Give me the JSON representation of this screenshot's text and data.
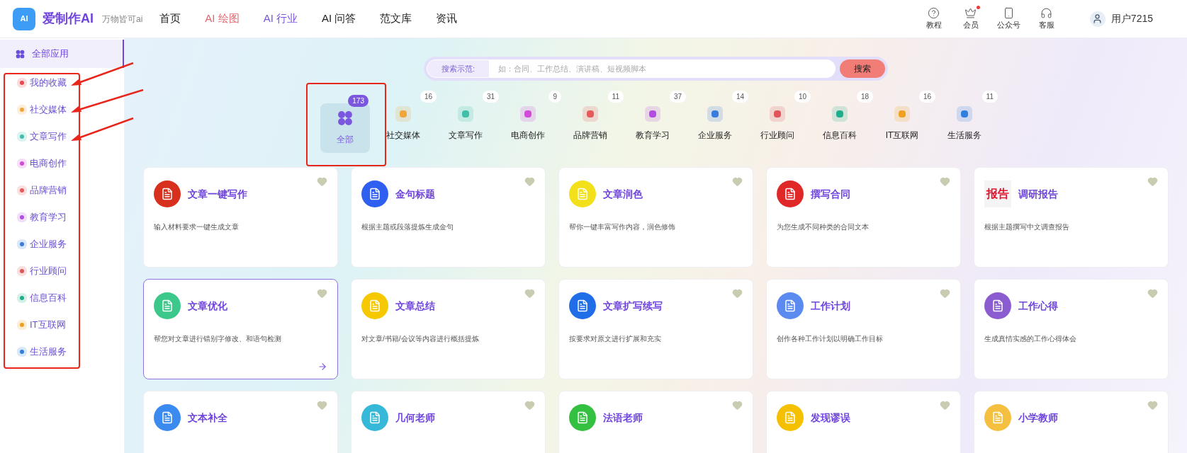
{
  "brand": {
    "name": "爱制作AI",
    "logo_text": "AI",
    "slogan": "万物皆可ai"
  },
  "nav": [
    {
      "label": "首页",
      "color": "#222222"
    },
    {
      "label": "AI 绘图",
      "color": "#e0676d"
    },
    {
      "label": "AI 行业",
      "color": "#7b56de"
    },
    {
      "label": "AI 问答",
      "color": "#222222"
    },
    {
      "label": "范文库",
      "color": "#222222"
    },
    {
      "label": "资讯",
      "color": "#222222"
    }
  ],
  "header_actions": [
    {
      "label": "教程",
      "kind": "help",
      "dot": false
    },
    {
      "label": "会员",
      "kind": "crown",
      "dot": true
    },
    {
      "label": "公众号",
      "kind": "phone",
      "dot": false
    },
    {
      "label": "客服",
      "kind": "headset",
      "dot": false
    }
  ],
  "user": {
    "name": "用户7215"
  },
  "sidebar": [
    {
      "label": "全部应用",
      "selected": true,
      "color": "#6b4fe0"
    },
    {
      "label": "我的收藏",
      "selected": false,
      "color": "#e8474f"
    },
    {
      "label": "社交媒体",
      "selected": false,
      "color": "#f0a53a"
    },
    {
      "label": "文章写作",
      "selected": false,
      "color": "#3fbfa8"
    },
    {
      "label": "电商创作",
      "selected": false,
      "color": "#d24ad8"
    },
    {
      "label": "品牌营销",
      "selected": false,
      "color": "#e55a5a"
    },
    {
      "label": "教育学习",
      "selected": false,
      "color": "#b24fe0"
    },
    {
      "label": "企业服务",
      "selected": false,
      "color": "#3a7be0"
    },
    {
      "label": "行业顾问",
      "selected": false,
      "color": "#e0555a"
    },
    {
      "label": "信息百科",
      "selected": false,
      "color": "#1fae8c"
    },
    {
      "label": "IT互联网",
      "selected": false,
      "color": "#f0a020"
    },
    {
      "label": "生活服务",
      "selected": false,
      "color": "#2f7fe0"
    }
  ],
  "search": {
    "label": "搜索示范:",
    "placeholder": "如：合同、工作总结、演讲稿、短视频脚本",
    "button": "搜索"
  },
  "categories": [
    {
      "label": "全部",
      "count": "173",
      "selected": true,
      "color": "#7b56de"
    },
    {
      "label": "社交媒体",
      "count": "16",
      "selected": false,
      "color": "#f0a53a"
    },
    {
      "label": "文章写作",
      "count": "31",
      "selected": false,
      "color": "#3fbfa8"
    },
    {
      "label": "电商创作",
      "count": "9",
      "selected": false,
      "color": "#d24ad8"
    },
    {
      "label": "品牌营销",
      "count": "11",
      "selected": false,
      "color": "#e55a5a"
    },
    {
      "label": "教育学习",
      "count": "37",
      "selected": false,
      "color": "#b24fe0"
    },
    {
      "label": "企业服务",
      "count": "14",
      "selected": false,
      "color": "#3a7be0"
    },
    {
      "label": "行业顾问",
      "count": "10",
      "selected": false,
      "color": "#e0555a"
    },
    {
      "label": "信息百科",
      "count": "18",
      "selected": false,
      "color": "#1fae8c"
    },
    {
      "label": "IT互联网",
      "count": "16",
      "selected": false,
      "color": "#f0a020"
    },
    {
      "label": "生活服务",
      "count": "11",
      "selected": false,
      "color": "#2f7fe0"
    }
  ],
  "cards": [
    {
      "title": "文章一键写作",
      "desc": "输入材料要求一键生成文章",
      "selected": false,
      "color": "#d8301f"
    },
    {
      "title": "金句标题",
      "desc": "根据主题或段落提炼生成金句",
      "selected": false,
      "color": "#2f5ff0"
    },
    {
      "title": "文章润色",
      "desc": "帮你一键丰富写作内容，润色修饰",
      "selected": false,
      "color": "#f2e01a"
    },
    {
      "title": "撰写合同",
      "desc": "为您生成不同种类的合同文本",
      "selected": false,
      "color": "#e02828"
    },
    {
      "title": "调研报告",
      "desc": "根据主题撰写中文调查报告",
      "selected": false,
      "color": "#e0152d",
      "icon_text": "报告"
    },
    {
      "title": "文章优化",
      "desc": "帮您对文章进行错别字修改、和语句检测",
      "selected": true,
      "color": "#3cc88a"
    },
    {
      "title": "文章总结",
      "desc": "对文章/书籍/会议等内容进行概括提炼",
      "selected": false,
      "color": "#f5c800"
    },
    {
      "title": "文章扩写续写",
      "desc": "按要求对原文进行扩展和充实",
      "selected": false,
      "color": "#1f6ee8"
    },
    {
      "title": "工作计划",
      "desc": "创作各种工作计划以明确工作目标",
      "selected": false,
      "color": "#5b8af0"
    },
    {
      "title": "工作心得",
      "desc": "生成真情实感的工作心得体会",
      "selected": false,
      "color": "#8a5cd0"
    },
    {
      "title": "文本补全",
      "selected": false,
      "color": "#3a8af0"
    },
    {
      "title": "几何老师",
      "selected": false,
      "color": "#36b8d8"
    },
    {
      "title": "法语老师",
      "selected": false,
      "color": "#34c040"
    },
    {
      "title": "发现谬误",
      "selected": false,
      "color": "#f5c000"
    },
    {
      "title": "小学教师",
      "selected": false,
      "color": "#f5c040"
    }
  ]
}
